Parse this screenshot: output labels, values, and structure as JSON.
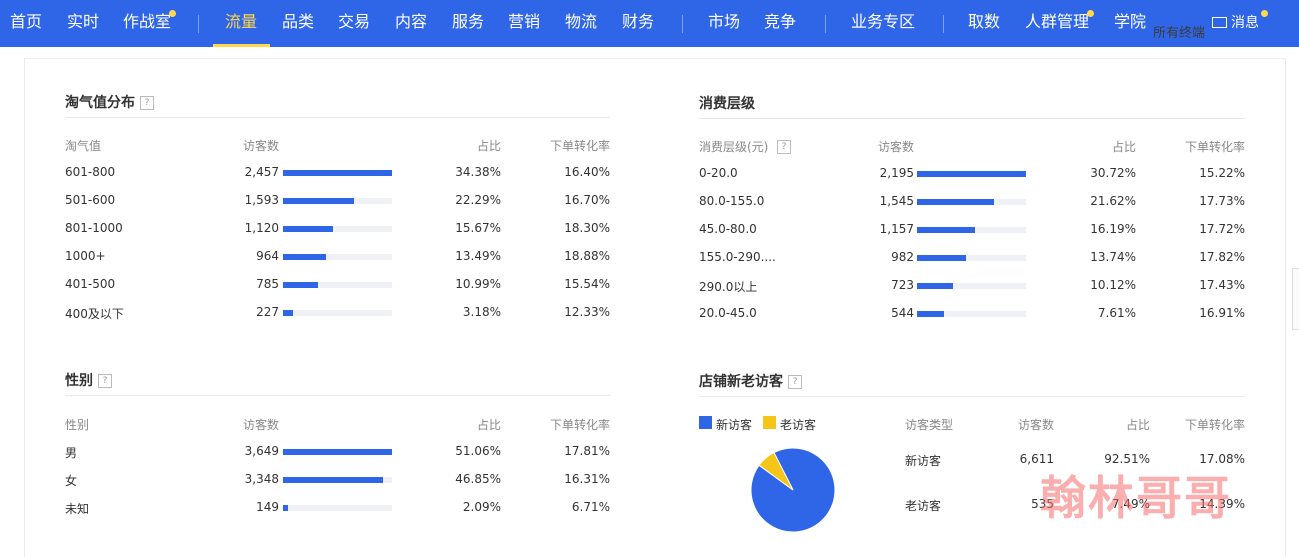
{
  "nav": {
    "items": [
      "首页",
      "实时",
      "作战室",
      "流量",
      "品类",
      "交易",
      "内容",
      "服务",
      "营销",
      "物流",
      "财务",
      "市场",
      "竞争",
      "业务专区",
      "取数",
      "人群管理",
      "学院"
    ],
    "active": "流量",
    "terminal_label": "所有终端",
    "message_label": "消息"
  },
  "colors": {
    "accent": "#2f66e8",
    "nav_active": "#ffd84d",
    "new_visitor": "#2f66e8",
    "old_visitor": "#f5c518"
  },
  "taoqi": {
    "title": "淘气值分布",
    "headers": [
      "淘气值",
      "访客数",
      "占比",
      "下单转化率"
    ],
    "rows": [
      {
        "label": "601-800",
        "visitors": "2,457",
        "share": "34.38%",
        "conv": "16.40%"
      },
      {
        "label": "501-600",
        "visitors": "1,593",
        "share": "22.29%",
        "conv": "16.70%"
      },
      {
        "label": "801-1000",
        "visitors": "1,120",
        "share": "15.67%",
        "conv": "18.30%"
      },
      {
        "label": "1000+",
        "visitors": "964",
        "share": "13.49%",
        "conv": "18.88%"
      },
      {
        "label": "401-500",
        "visitors": "785",
        "share": "10.99%",
        "conv": "15.54%"
      },
      {
        "label": "400及以下",
        "visitors": "227",
        "share": "3.18%",
        "conv": "12.33%"
      }
    ]
  },
  "consumption": {
    "title": "消费层级",
    "headers": [
      "消费层级(元)",
      "访客数",
      "占比",
      "下单转化率"
    ],
    "rows": [
      {
        "label": "0-20.0",
        "visitors": "2,195",
        "share": "30.72%",
        "conv": "15.22%"
      },
      {
        "label": "80.0-155.0",
        "visitors": "1,545",
        "share": "21.62%",
        "conv": "17.73%"
      },
      {
        "label": "45.0-80.0",
        "visitors": "1,157",
        "share": "16.19%",
        "conv": "17.72%"
      },
      {
        "label": "155.0-290....",
        "visitors": "982",
        "share": "13.74%",
        "conv": "17.82%"
      },
      {
        "label": "290.0以上",
        "visitors": "723",
        "share": "10.12%",
        "conv": "17.43%"
      },
      {
        "label": "20.0-45.0",
        "visitors": "544",
        "share": "7.61%",
        "conv": "16.91%"
      }
    ]
  },
  "gender": {
    "title": "性别",
    "headers": [
      "性别",
      "访客数",
      "占比",
      "下单转化率"
    ],
    "rows": [
      {
        "label": "男",
        "visitors": "3,649",
        "share": "51.06%",
        "conv": "17.81%"
      },
      {
        "label": "女",
        "visitors": "3,348",
        "share": "46.85%",
        "conv": "16.31%"
      },
      {
        "label": "未知",
        "visitors": "149",
        "share": "2.09%",
        "conv": "6.71%"
      }
    ]
  },
  "visitors": {
    "title": "店铺新老访客",
    "legend": [
      "新访客",
      "老访客"
    ],
    "headers": [
      "访客类型",
      "访客数",
      "占比",
      "下单转化率"
    ],
    "rows": [
      {
        "label": "新访客",
        "visitors": "6,611",
        "share": "92.51%",
        "conv": "17.08%"
      },
      {
        "label": "老访客",
        "visitors": "535",
        "share": "7.49%",
        "conv": "14.39%"
      }
    ],
    "pie_shares": [
      0.9251,
      0.0749
    ]
  },
  "watermark": "翰林哥哥"
}
